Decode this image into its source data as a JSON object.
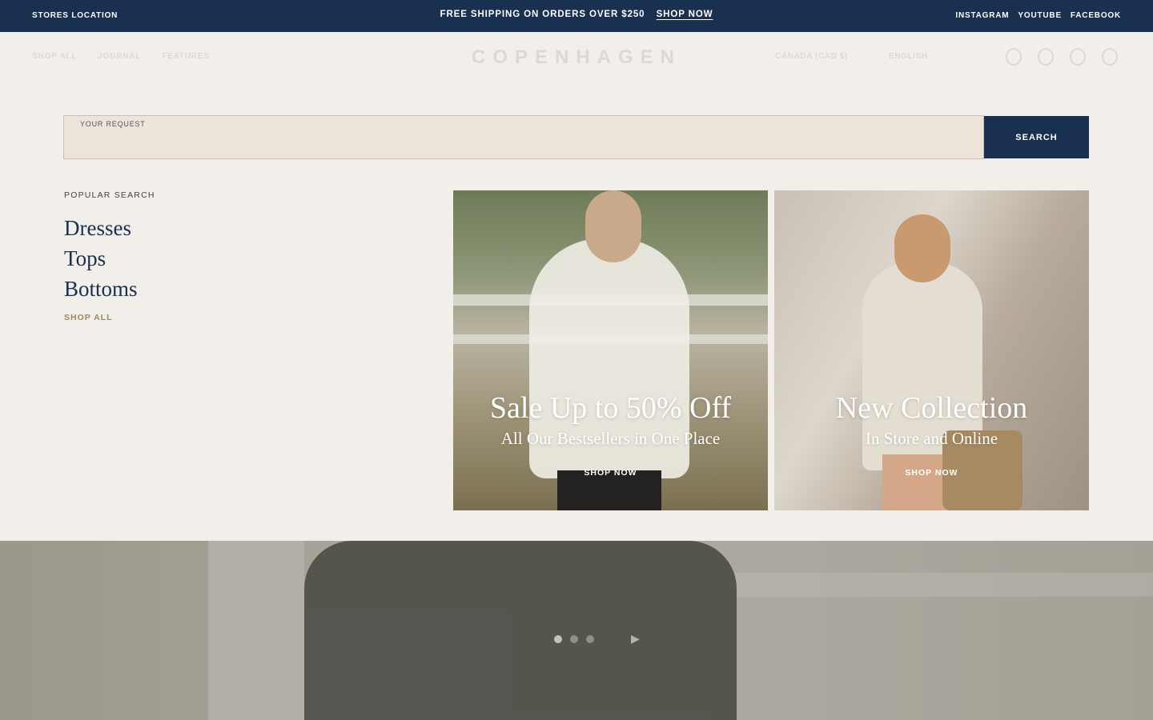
{
  "topbar": {
    "stores_label": "STORES LOCATION",
    "promo_text": "FREE SHIPPING ON ORDERS OVER $250",
    "promo_link": "SHOP NOW",
    "social": [
      "INSTAGRAM",
      "YOUTUBE",
      "FACEBOOK"
    ]
  },
  "header": {
    "nav": [
      "SHOP ALL",
      "JOURNAL",
      "FEATURES"
    ],
    "logo": "COPENHAGEN",
    "country": "CANADA (CAD $)",
    "language": "ENGLISH"
  },
  "search": {
    "label": "YOUR REQUEST",
    "value": "",
    "button": "SEARCH"
  },
  "popular": {
    "title": "POPULAR SEARCH",
    "items": [
      "Dresses",
      "Tops",
      "Bottoms"
    ],
    "shop_all": "SHOP ALL"
  },
  "promos": [
    {
      "title": "Sale Up to 50% Off",
      "subtitle": "All Our Bestsellers in One Place",
      "cta": "SHOP NOW"
    },
    {
      "title": "New Collection",
      "subtitle": "In Store and Online",
      "cta": "SHOP NOW"
    }
  ],
  "colors": {
    "navy": "#1a3050",
    "background": "#f2eee9",
    "input_bg": "#ede4dc",
    "accent_gold": "#9a8a5a"
  }
}
